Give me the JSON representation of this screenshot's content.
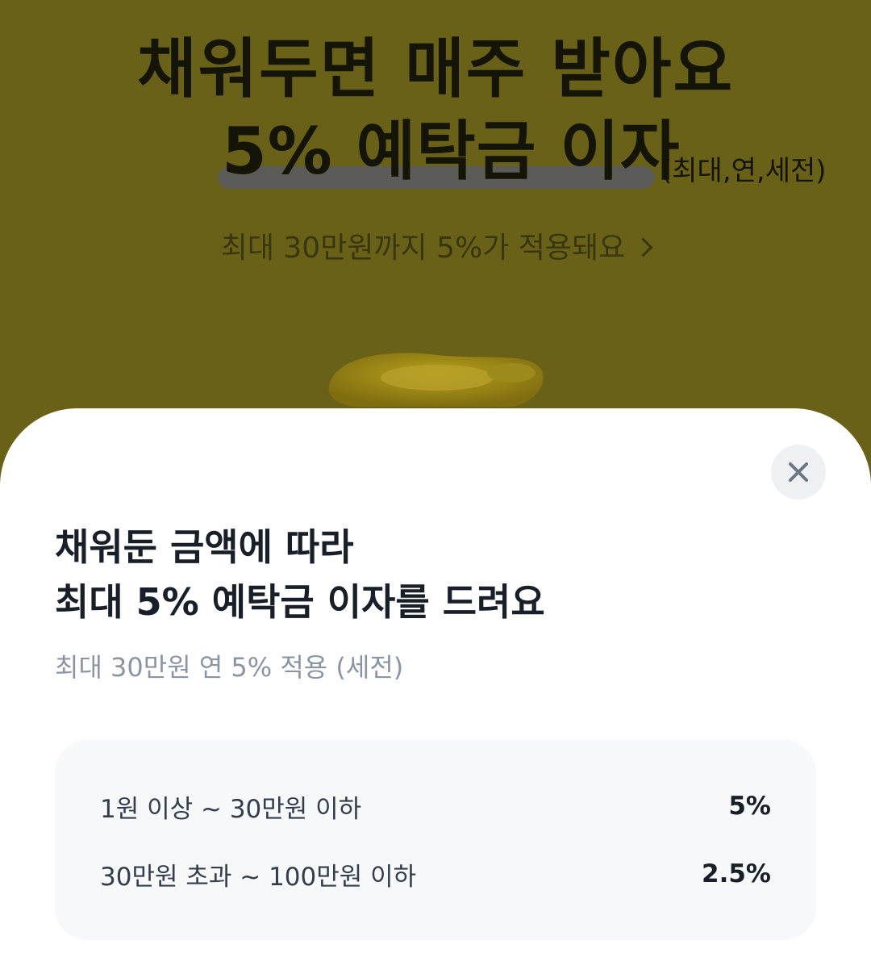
{
  "promo": {
    "title_line1": "채워두면 매주 받아요",
    "title_line2": "5% 예탁금 이자",
    "title_note": "(최대,연,세전)",
    "subtitle": "최대 30만원까지 5%가 적용돼요"
  },
  "sheet": {
    "title_line1": "채워둔 금액에 따라",
    "title_line2": "최대 5% 예탁금 이자를 드려요",
    "description": "최대 30만원 연 5% 적용 (세전)",
    "rates": [
      {
        "range": "1원 이상 ~ 30만원 이하",
        "rate": "5%"
      },
      {
        "range": "30만원 초과 ~ 100만원 이하",
        "rate": "2.5%"
      }
    ]
  },
  "icons": {
    "close": "close-icon",
    "subtitle_arrow": "chevron-right-icon",
    "illustration": "coin-illustration"
  },
  "colors": {
    "promo_background": "#6a6118",
    "sheet_background": "#ffffff",
    "rate_box_background": "#f7f8fa",
    "close_button_background": "#eef0f3"
  }
}
